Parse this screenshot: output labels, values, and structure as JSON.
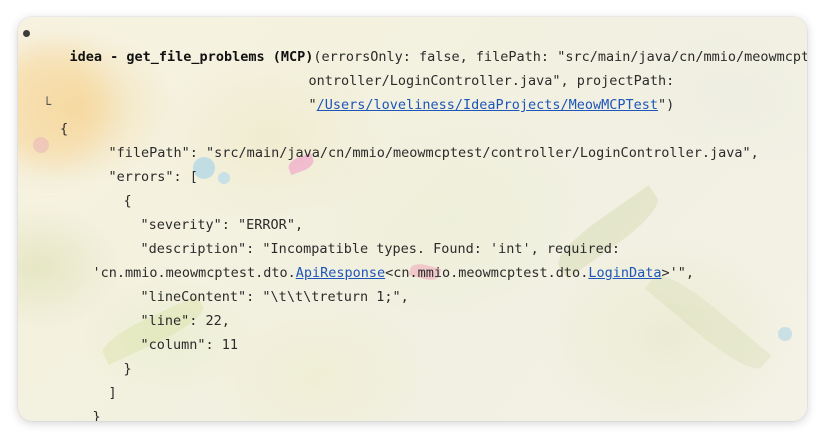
{
  "tool_call": {
    "name": "idea - get_file_problems (MCP)",
    "args_line1": "(errorsOnly: false, filePath: \"src/main/java/cn/mmio/meowmcptest/c",
    "args_line2": "ontroller/LoginController.java\", projectPath:",
    "args_line3_open_quote": "\"",
    "project_path_link": "/Users/loveliness/IdeaProjects/MeowMCPTest",
    "args_line3_close": "\")"
  },
  "result": {
    "tree_connector": "└",
    "open_brace": "{",
    "file_path_line": "\"filePath\": \"src/main/java/cn/mmio/meowmcptest/controller/LoginController.java\",",
    "errors_line": "\"errors\": [",
    "error_open": "{",
    "severity_line": "\"severity\": \"ERROR\",",
    "description_line": "\"description\": \"Incompatible types. Found: 'int', required:",
    "description_cont_prefix": "'cn.mmio.meowmcptest.dto.",
    "description_link1": "ApiResponse",
    "description_cont_mid": "<cn.mmio.meowmcptest.dto.",
    "description_link2": "LoginData",
    "description_cont_suffix": ">'\",",
    "line_content_line": "\"lineContent\": \"\\t\\t\\treturn 1;\",",
    "line_number_line": "\"line\": 22,",
    "column_line": "\"column\": 11",
    "error_close": "}",
    "errors_close": "]",
    "close_brace": "}"
  }
}
